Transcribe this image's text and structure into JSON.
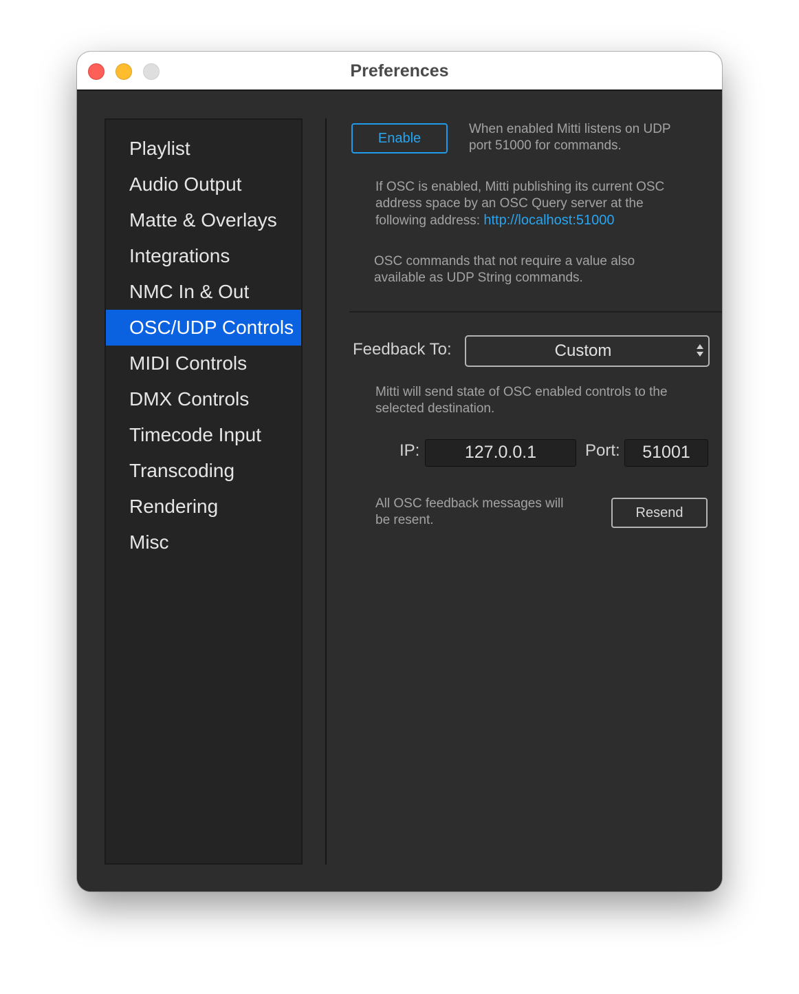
{
  "window": {
    "title": "Preferences"
  },
  "sidebar": {
    "selected_index": 5,
    "items": [
      {
        "label": "Playlist"
      },
      {
        "label": "Audio Output"
      },
      {
        "label": "Matte & Overlays"
      },
      {
        "label": "Integrations"
      },
      {
        "label": "NMC In & Out"
      },
      {
        "label": "OSC/UDP Controls"
      },
      {
        "label": "MIDI Controls"
      },
      {
        "label": "DMX Controls"
      },
      {
        "label": "Timecode Input"
      },
      {
        "label": "Transcoding"
      },
      {
        "label": "Rendering"
      },
      {
        "label": "Misc"
      }
    ]
  },
  "osc": {
    "enable_label": "Enable",
    "enable_desc_line1": "When enabled Mitti listens on UDP",
    "enable_desc_line2": "port 51000 for commands.",
    "query_line1": "If OSC is enabled, Mitti publishing its current OSC",
    "query_line2": "address space by an OSC Query server at the",
    "query_line3": "following address:",
    "query_url": "http://localhost:51000",
    "udp_line1": "OSC commands that not require a value also",
    "udp_line2": "available as UDP String commands."
  },
  "feedback": {
    "label": "Feedback To:",
    "selected": "Custom",
    "desc_line1": "Mitti will send state of OSC enabled controls to the",
    "desc_line2": "selected destination.",
    "ip_label": "IP:",
    "ip_value": "127.0.0.1",
    "port_label": "Port:",
    "port_value": "51001",
    "resend_desc_line1": "All OSC feedback messages will",
    "resend_desc_line2": "be resent.",
    "resend_label": "Resend"
  },
  "colors": {
    "accent": "#0a62e0",
    "link": "#27a5f2",
    "background": "#2d2d2d",
    "sidebar": "#242424"
  }
}
